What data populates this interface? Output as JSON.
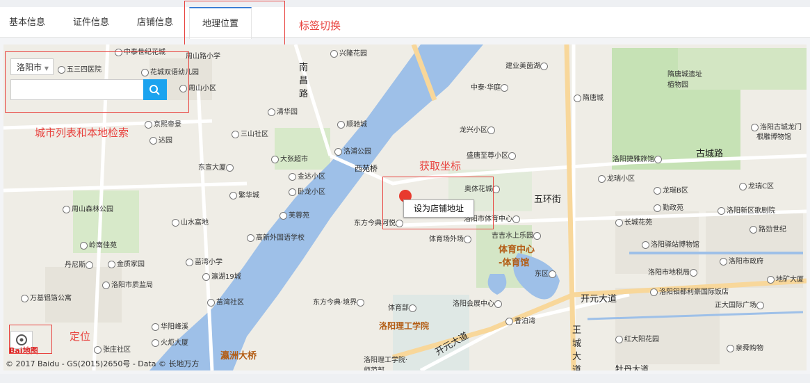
{
  "tabs": [
    {
      "label": "基本信息",
      "active": false
    },
    {
      "label": "证件信息",
      "active": false
    },
    {
      "label": "店铺信息",
      "active": false
    },
    {
      "label": "地理位置",
      "active": true
    }
  ],
  "annotations": {
    "tab_switch": "标签切换",
    "city_search": "城市列表和本地检索",
    "get_coords": "获取坐标",
    "locate": "定位"
  },
  "map": {
    "city_select": "洛阳市",
    "search_placeholder": "",
    "tooltip": "设为店铺地址",
    "copyright": "© 2017 Baidu - GS(2015)2650号 - Data © 长地万方",
    "logo": "Bai地图",
    "pois": [
      "中泰世纪花城",
      "五三四医院",
      "花城双语幼儿园",
      "周山小区",
      "周山路小学",
      "兴隆花园",
      "建业美茵湖",
      "隋唐城遗址植物园",
      "中泰·华庭",
      "隋唐城",
      "清华园",
      "顺驰城",
      "京熙帝景",
      "三山社区",
      "达园",
      "龙兴小区",
      "盛唐至尊小区",
      "洛阳古城龙门",
      "根雕博物馆",
      "洛浦公园",
      "大张超市",
      "东宣大厦",
      "金达小区",
      "洛阳捷雅旅馆",
      "卧龙小区",
      "龙瑞小区",
      "龙瑞B区",
      "龙瑞C区",
      "繁华城",
      "周山森林公园",
      "奥体花城",
      "勤政苑",
      "洛阳新区歌剧院",
      "芙蓉苑",
      "山水富地",
      "东方今典河悦",
      "洛阳市体育中心",
      "长城花苑",
      "路劲世纪",
      "高新外国语学校",
      "体育场外场",
      "吉吉水上乐园",
      "洛阳驿站博物馆",
      "岭南佳苑",
      "苗湾小学",
      "丹尼斯",
      "金质家园",
      "瀛湖19城",
      "洛阳市质监局",
      "东区",
      "洛阳市地税局",
      "洛阳市政府",
      "地矿大厦",
      "苗湾社区",
      "万基铝箔公寓",
      "东方今典·境界",
      "洛阳会展中心",
      "洛阳钼都利豪国际饭店",
      "正大国际广场",
      "体育部",
      "华阳峰溪",
      "香泊湾",
      "火炬大厦",
      "张庄社区",
      "红大阳花园",
      "泉舜购物",
      "洛阳理工学院·师范部",
      "洛阳理工学院"
    ],
    "roads": [
      "南昌路",
      "西苑桥",
      "古城路",
      "五环街",
      "开元大道",
      "王城大道",
      "瀛洲大桥",
      "牡丹大道"
    ],
    "highlights": [
      "体育中心 -体育馆"
    ]
  }
}
